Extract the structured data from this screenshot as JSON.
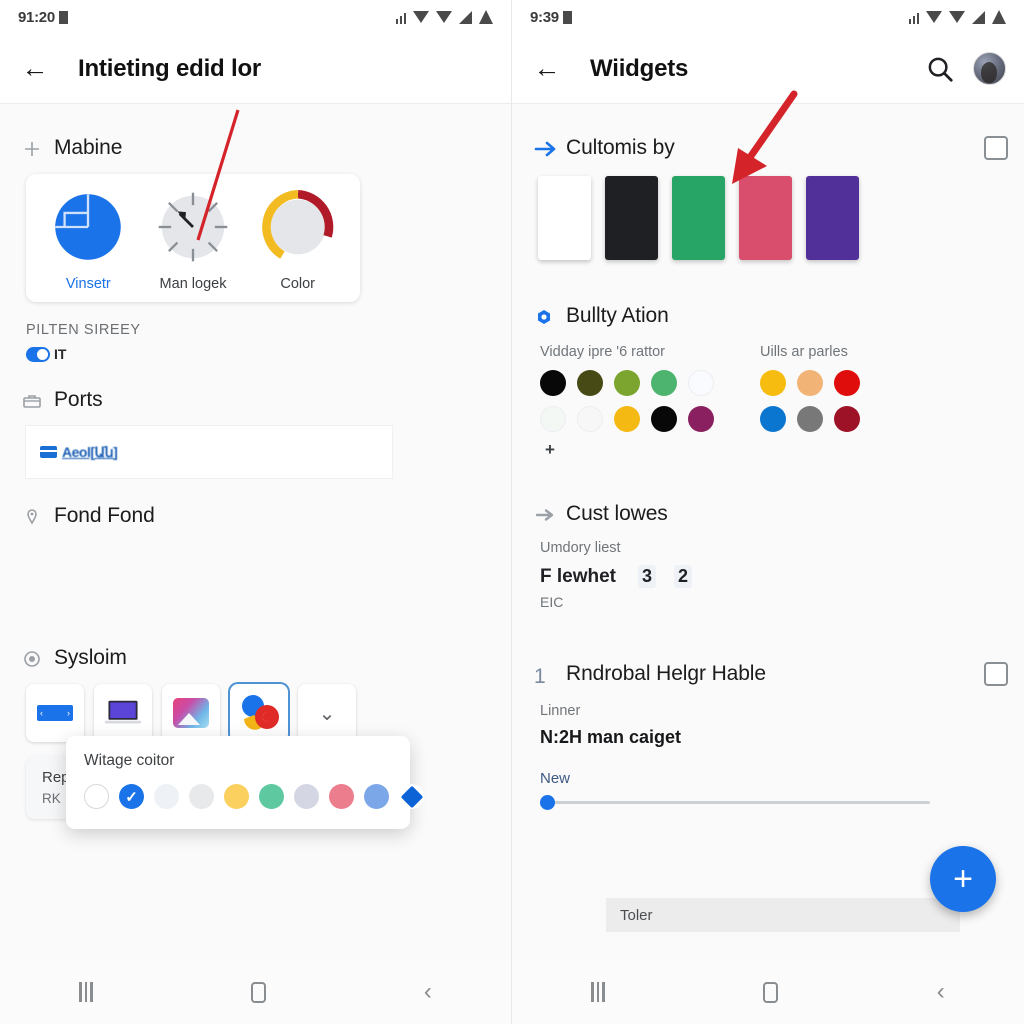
{
  "left": {
    "status": {
      "time": "91:20",
      "icons": [
        "signal-bars-icon",
        "wifi-icon",
        "wifi-icon",
        "triangle-signal-icon",
        "battery-icon"
      ]
    },
    "appbar": {
      "back": "←",
      "title": "Intieting edid lor"
    },
    "sections": [
      {
        "icon": "plus-icon",
        "title": "Mabine",
        "tiles": [
          {
            "label": "Vinsetr",
            "icon": "pie-chart-icon",
            "active": true
          },
          {
            "label": "Man logek",
            "icon": "clock-spinner-icon",
            "active": false
          },
          {
            "label": "Color",
            "icon": "gauge-ring-icon",
            "active": false
          }
        ],
        "caps_label": "PILTEN SIREEY",
        "toggle_text": "IT"
      },
      {
        "icon": "briefcase-icon",
        "title": "Ports",
        "link_text": "Aeol[Ան]"
      },
      {
        "icon": "pin-icon",
        "title": "Fond Fond"
      },
      {
        "icon": "radio-dot-icon",
        "title": "Sysloim",
        "tiles": [
          "banner-icon",
          "laptop-icon",
          "gradient-image-icon",
          "multicolor-blobs-icon",
          "chevron-down-icon"
        ],
        "list_card": {
          "title": "Repacle ligole",
          "sub": "RK",
          "check": "✓"
        }
      }
    ],
    "popup": {
      "title": "Witage coitor",
      "swatches": [
        {
          "name": "white",
          "color": "#ffffff",
          "outline": true
        },
        {
          "name": "blue-selected",
          "color": "#1a73e8",
          "checked": true
        },
        {
          "name": "pale-blue-gray",
          "color": "#eef1f6"
        },
        {
          "name": "light-gray",
          "color": "#e8e9ea"
        },
        {
          "name": "yellow",
          "color": "#fbd05e"
        },
        {
          "name": "teal-green",
          "color": "#5ec9a0"
        },
        {
          "name": "lavender-gray",
          "color": "#d4d7e3"
        },
        {
          "name": "pink-red",
          "color": "#ec7d8d"
        },
        {
          "name": "periwinkle",
          "color": "#7ba7e8"
        },
        {
          "name": "blue-diamond",
          "color": "#0b63d6",
          "diamond": true
        }
      ]
    },
    "navbar": {
      "recents": "recents-icon",
      "home": "home-icon",
      "back": "back-icon"
    }
  },
  "right": {
    "status": {
      "time": "9:39",
      "icons": [
        "signal-bars-icon",
        "wifi-icon",
        "wifi-icon",
        "triangle-signal-icon",
        "battery-icon"
      ]
    },
    "appbar": {
      "back": "←",
      "title": "Wiidgets",
      "search": "search-icon",
      "avatar": "avatar"
    },
    "sections": [
      {
        "icon": "arrow-right-blue-icon",
        "title": "Cultomis by",
        "checkbox": true,
        "palette": [
          {
            "name": "white",
            "color": "#ffffff"
          },
          {
            "name": "near-black",
            "color": "#1f2023"
          },
          {
            "name": "green",
            "color": "#27a567"
          },
          {
            "name": "pink",
            "color": "#d94e6c"
          },
          {
            "name": "purple",
            "color": "#52309a"
          }
        ]
      },
      {
        "icon": "blue-hex-dot-icon",
        "title": "Bullty Ation",
        "dot_groups": [
          {
            "label": "Vidday ipre '6 rattor",
            "rows": [
              [
                {
                  "color": "#080808"
                },
                {
                  "color": "#474a15"
                },
                {
                  "color": "#7ba52e"
                },
                {
                  "color": "#4cb46e"
                },
                {
                  "color": "#fafbfe",
                  "faint": true
                }
              ],
              [
                {
                  "color": "#f4f8f4",
                  "faint": true
                },
                {
                  "color": "#f7f7f8",
                  "faint": true
                },
                {
                  "color": "#f5b913"
                },
                {
                  "color": "#080808"
                },
                {
                  "color": "#8a2060"
                }
              ]
            ],
            "plus": "+"
          },
          {
            "label": "Uills ar parles",
            "rows": [
              [
                {
                  "color": "#f6bd10"
                },
                {
                  "color": "#f2b476"
                },
                {
                  "color": "#e00d0d"
                }
              ],
              [
                {
                  "color": "#0b76d0"
                },
                {
                  "color": "#787878"
                },
                {
                  "color": "#9e1228"
                }
              ]
            ]
          }
        ]
      },
      {
        "icon": "arrow-right-gray-icon",
        "title": "Cust lowes",
        "kv": {
          "label": "Umdory liest",
          "value": "F lewhet",
          "nums": [
            "3",
            "2"
          ],
          "sub": "EIC"
        }
      },
      {
        "icon": "number-icon",
        "icon_text": "1",
        "title": "Rndrobal Helgr Hable",
        "checkbox": true,
        "kv": {
          "label": "Linner",
          "strong": "N:2H man caiget"
        },
        "slider": {
          "label": "New",
          "value": 0
        }
      }
    ],
    "bottom_bar": {
      "text": "Toler"
    },
    "fab": {
      "label": "+"
    },
    "navbar": {
      "recents": "recents-icon",
      "home": "home-icon",
      "back": "back-icon"
    }
  },
  "annotations": {
    "accent_red": "#d4242a",
    "arrow_left": "pointer-line-to-chart-card",
    "arrow_right": "red-arrow-to-black-palette-card"
  }
}
